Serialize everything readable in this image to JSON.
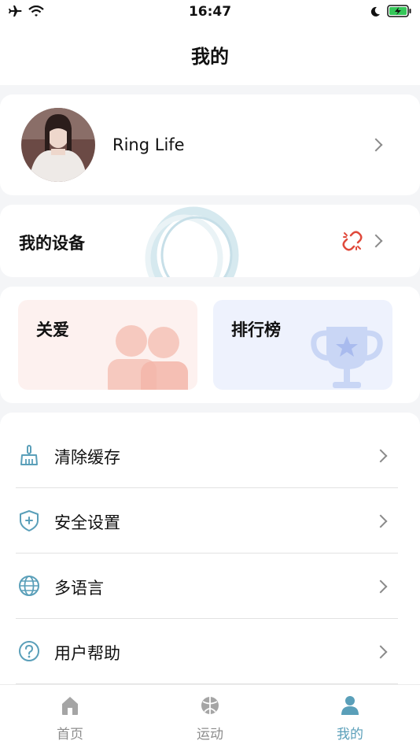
{
  "status_bar": {
    "time": "16:47"
  },
  "header": {
    "title": "我的"
  },
  "profile": {
    "name": "Ring Life"
  },
  "device": {
    "label": "我的设备"
  },
  "tiles": {
    "care": "关爱",
    "ranking": "排行榜"
  },
  "menu": {
    "items": [
      {
        "label": "清除缓存",
        "icon": "broom-icon"
      },
      {
        "label": "安全设置",
        "icon": "shield-plus-icon"
      },
      {
        "label": "多语言",
        "icon": "globe-icon"
      },
      {
        "label": "用户帮助",
        "icon": "question-circle-icon"
      }
    ]
  },
  "tabbar": {
    "tabs": [
      {
        "label": "首页",
        "icon": "home-icon"
      },
      {
        "label": "运动",
        "icon": "ball-icon"
      },
      {
        "label": "我的",
        "icon": "person-icon"
      }
    ],
    "active": "我的"
  },
  "colors": {
    "accent": "#5a9fb9",
    "unlink": "#e04a3c",
    "battery": "#35c759"
  }
}
